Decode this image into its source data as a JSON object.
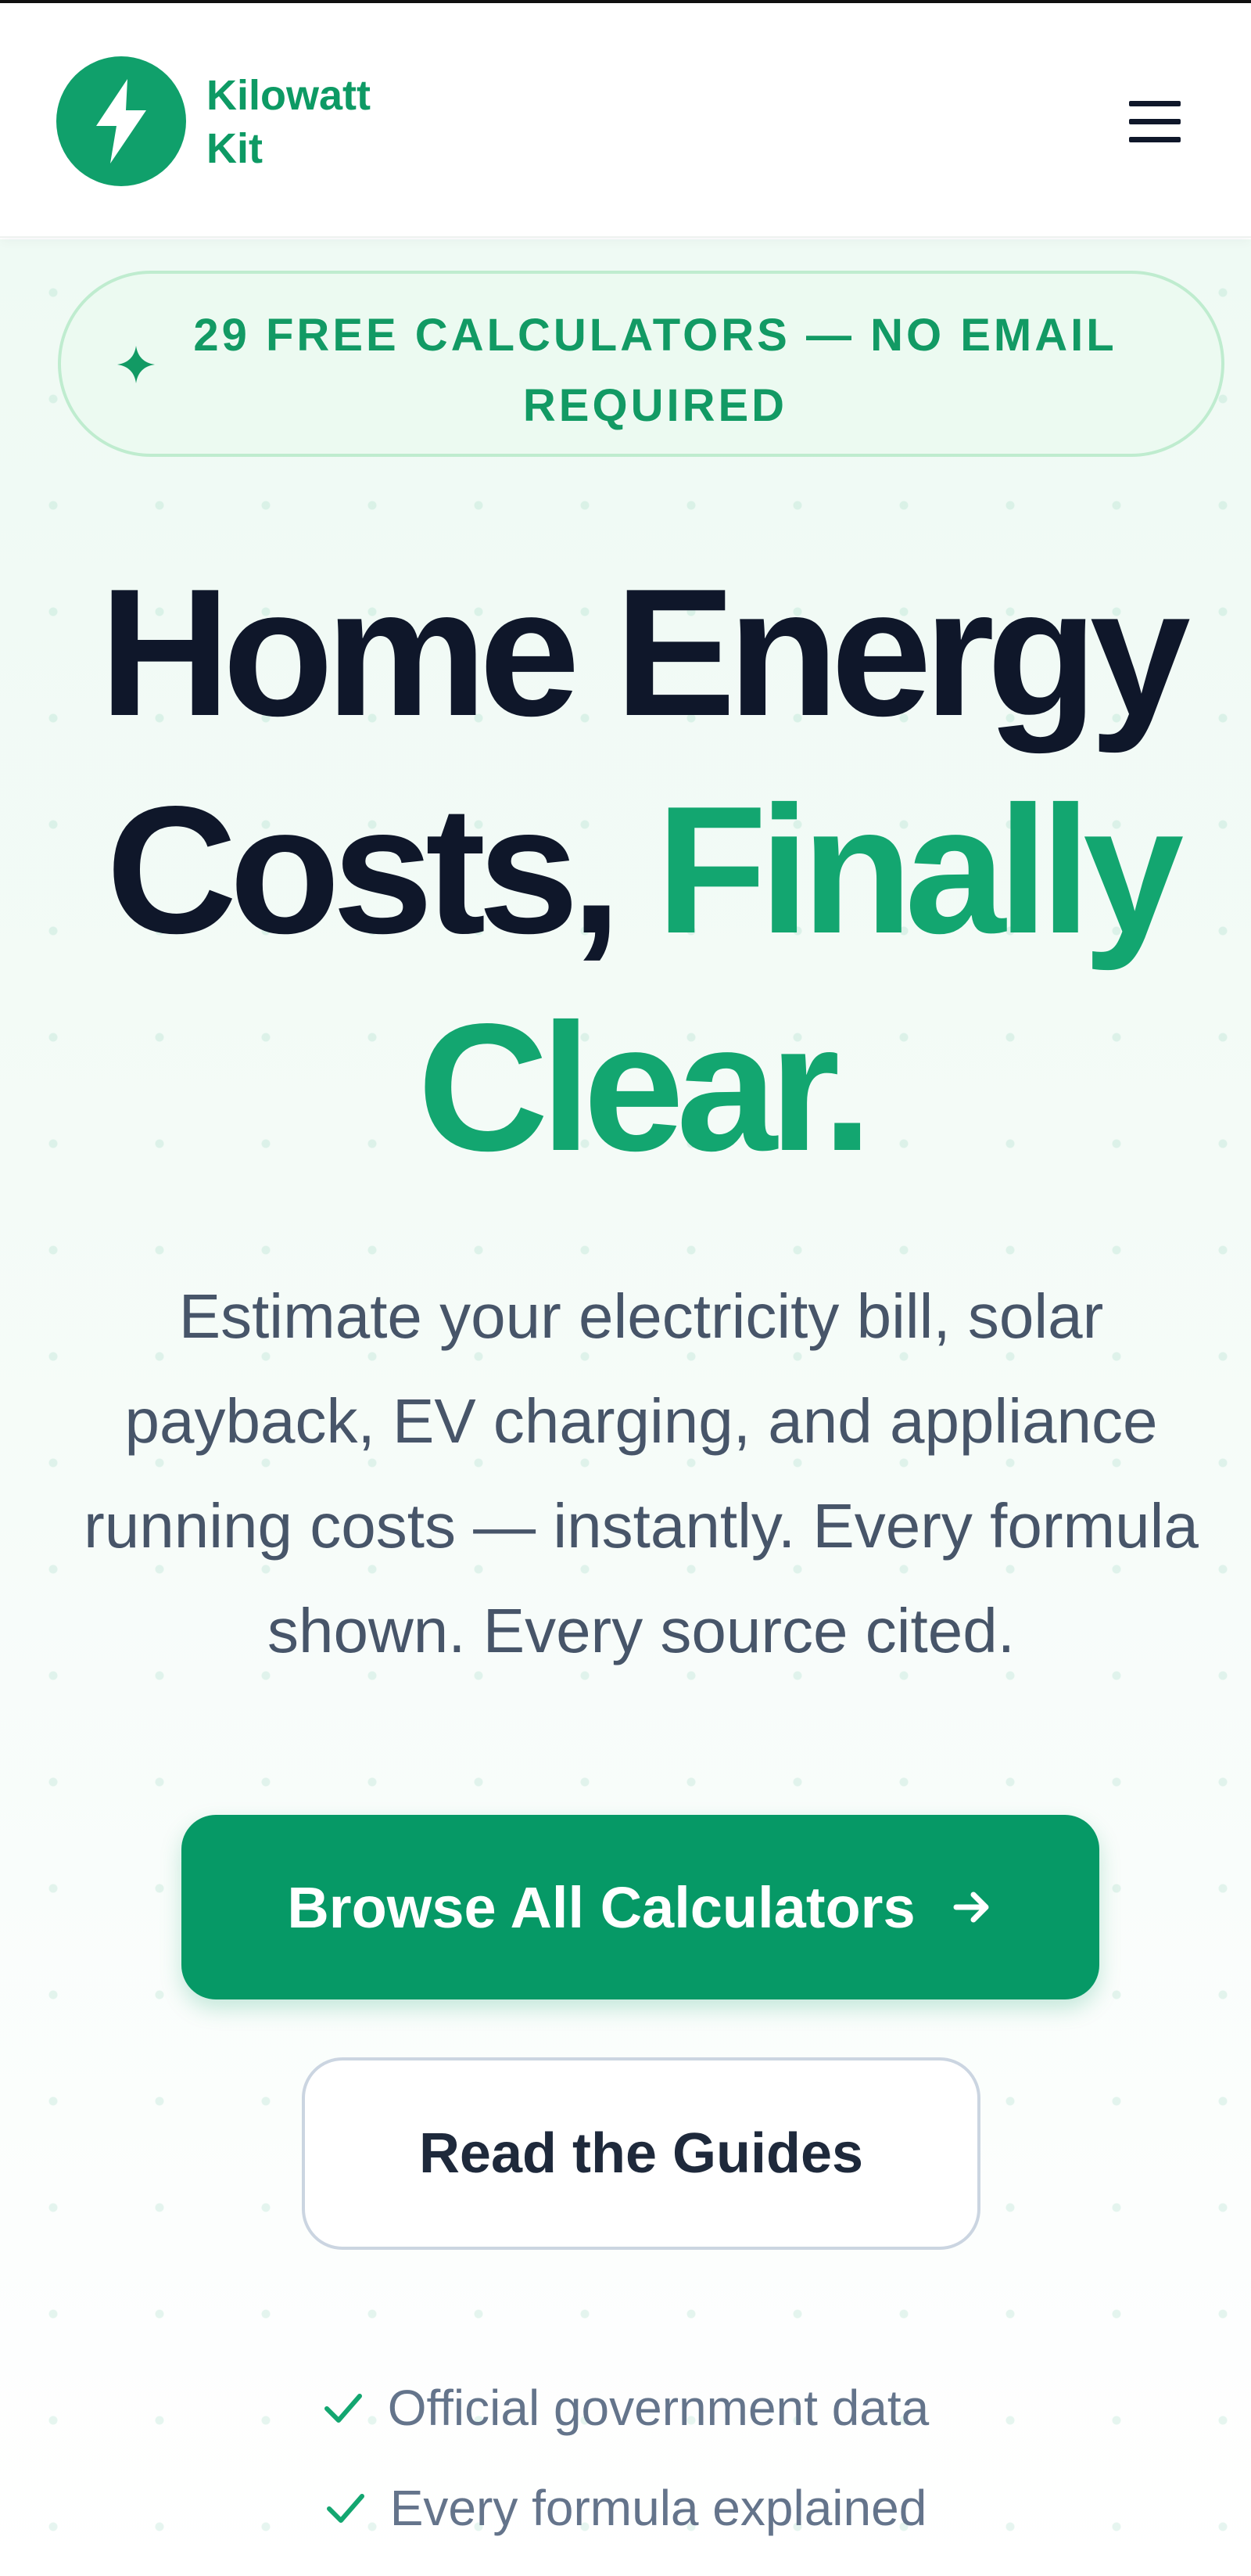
{
  "header": {
    "brand_line1": "Kilowatt",
    "brand_line2": "Kit",
    "logo_icon": "lightning-bolt-icon",
    "menu_icon": "hamburger-menu-icon"
  },
  "hero": {
    "badge_icon": "sparkle-icon",
    "badge_text": "29 FREE CALCULATORS — NO EMAIL REQUIRED",
    "headline_part1": "Home Energy Costs,",
    "headline_accent": "Finally Clear.",
    "subtext": "Estimate your electricity bill, solar payback, EV charging, and appliance running costs — instantly. Every formula shown. Every source cited.",
    "primary_cta": "Browse All Calculators",
    "primary_cta_icon": "arrow-right-icon",
    "secondary_cta": "Read the Guides",
    "checks": [
      "Official government data",
      "Every formula explained"
    ],
    "check_icon": "checkmark-icon"
  },
  "colors": {
    "brand_green": "#10a06b",
    "cta_green": "#069966",
    "headline_dark": "#0f172a",
    "body_gray": "#475569"
  }
}
